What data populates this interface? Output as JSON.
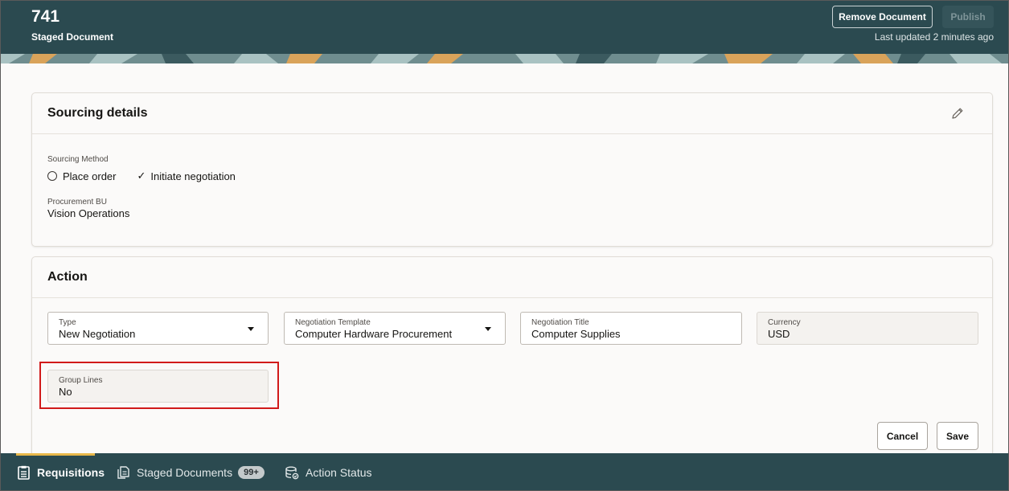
{
  "header": {
    "document_number": "741",
    "subtitle": "Staged Document",
    "remove_label": "Remove Document",
    "publish_label": "Publish",
    "last_updated": "Last updated 2 minutes ago"
  },
  "sourcing": {
    "title": "Sourcing details",
    "method_label": "Sourcing Method",
    "option_place_order": "Place order",
    "option_initiate": "Initiate negotiation",
    "selected_option": "Initiate negotiation",
    "bu_label": "Procurement BU",
    "bu_value": "Vision Operations"
  },
  "action": {
    "title": "Action",
    "type": {
      "label": "Type",
      "value": "New Negotiation"
    },
    "template": {
      "label": "Negotiation Template",
      "value": "Computer Hardware Procurement"
    },
    "neg_title": {
      "label": "Negotiation Title",
      "value": "Computer Supplies"
    },
    "currency": {
      "label": "Currency",
      "value": "USD"
    },
    "group_lines": {
      "label": "Group Lines",
      "value": "No"
    },
    "cancel_label": "Cancel",
    "save_label": "Save"
  },
  "footer": {
    "tabs": [
      {
        "label": "Requisitions",
        "active": true,
        "icon": "clipboard-icon"
      },
      {
        "label": "Staged Documents",
        "badge": "99+",
        "icon": "documents-icon"
      },
      {
        "label": "Action Status",
        "icon": "database-sync-icon"
      }
    ]
  },
  "colors": {
    "header_bg": "#2b4a50",
    "accent_tab": "#e8b84a",
    "highlight_border": "#d11a1a"
  }
}
